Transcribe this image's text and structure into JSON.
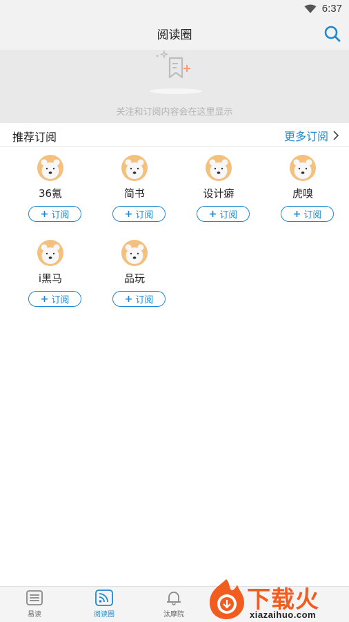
{
  "status_bar": {
    "time": "6:37"
  },
  "header": {
    "title": "阅读圈"
  },
  "empty_state": {
    "message": "关注和订阅内容会在这里显示"
  },
  "recommend": {
    "title": "推荐订阅",
    "more_label": "更多订阅",
    "subscribe_label": "订阅",
    "items": [
      {
        "name": "36氪"
      },
      {
        "name": "简书"
      },
      {
        "name": "设计癖"
      },
      {
        "name": "虎嗅"
      },
      {
        "name": "i黑马"
      },
      {
        "name": "品玩"
      }
    ]
  },
  "bottom_nav": {
    "items": [
      {
        "label": "易读"
      },
      {
        "label": "阅读圈"
      },
      {
        "label": "汰摩院"
      }
    ]
  },
  "watermark": {
    "cn": "下载火",
    "en": "xiazaihuo.com"
  },
  "colors": {
    "accent": "#1e88d2",
    "avatar_bg": "#f3c07e",
    "watermark": "#f25c1f"
  }
}
